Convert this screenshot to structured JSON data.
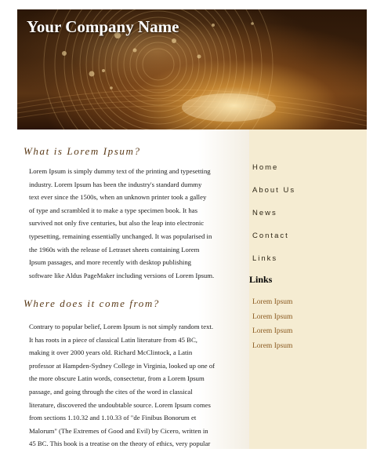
{
  "header": {
    "company_name": "Your Company Name"
  },
  "main": {
    "sections": [
      {
        "heading": "What is Lorem Ipsum?",
        "lines": [
          "Lorem Ipsum is simply dummy text of the printing and typesetting",
          "industry. Lorem Ipsum has been the industry's standard dummy",
          "text ever since the 1500s, when an unknown printer took a galley",
          "of type and scrambled it to make a type specimen book. It has",
          "survived not only five centuries, but also the leap into electronic",
          "typesetting, remaining essentially unchanged. It was popularised in",
          "the 1960s with the release of Letraset sheets containing Lorem",
          "Ipsum passages, and more recently with desktop publishing",
          "software like Aldus PageMaker including versions of Lorem Ipsum."
        ]
      },
      {
        "heading": "Where does it come from?",
        "lines": [
          "Contrary to popular belief, Lorem Ipsum is not simply random text.",
          "It has roots in a piece of classical Latin literature from 45 BC,",
          "making it over 2000 years old. Richard McClintock, a Latin",
          "professor at Hampden-Sydney College in Virginia, looked up one of",
          "the more obscure Latin words, consectetur, from a Lorem Ipsum",
          "passage, and going through the cites of the word in classical",
          "literature, discovered the undoubtable source. Lorem Ipsum comes",
          "from sections 1.10.32 and 1.10.33 of \"de Finibus Bonorum et",
          "Malorum\" (The Extremes of Good and Evil) by Cicero, written in",
          "45 BC. This book is a treatise on the theory of ethics, very popular"
        ]
      }
    ]
  },
  "sidebar": {
    "nav": [
      "Home",
      "About Us",
      "News",
      "Contact",
      "Links"
    ],
    "links_heading": "Links",
    "links": [
      "Lorem Ipsum",
      "Lorem Ipsum",
      "Lorem Ipsum",
      "Lorem Ipsum"
    ]
  },
  "colors": {
    "heading": "#5a3a18",
    "sidebar_bg": "#f5ecd2",
    "link": "#8a5a20"
  }
}
